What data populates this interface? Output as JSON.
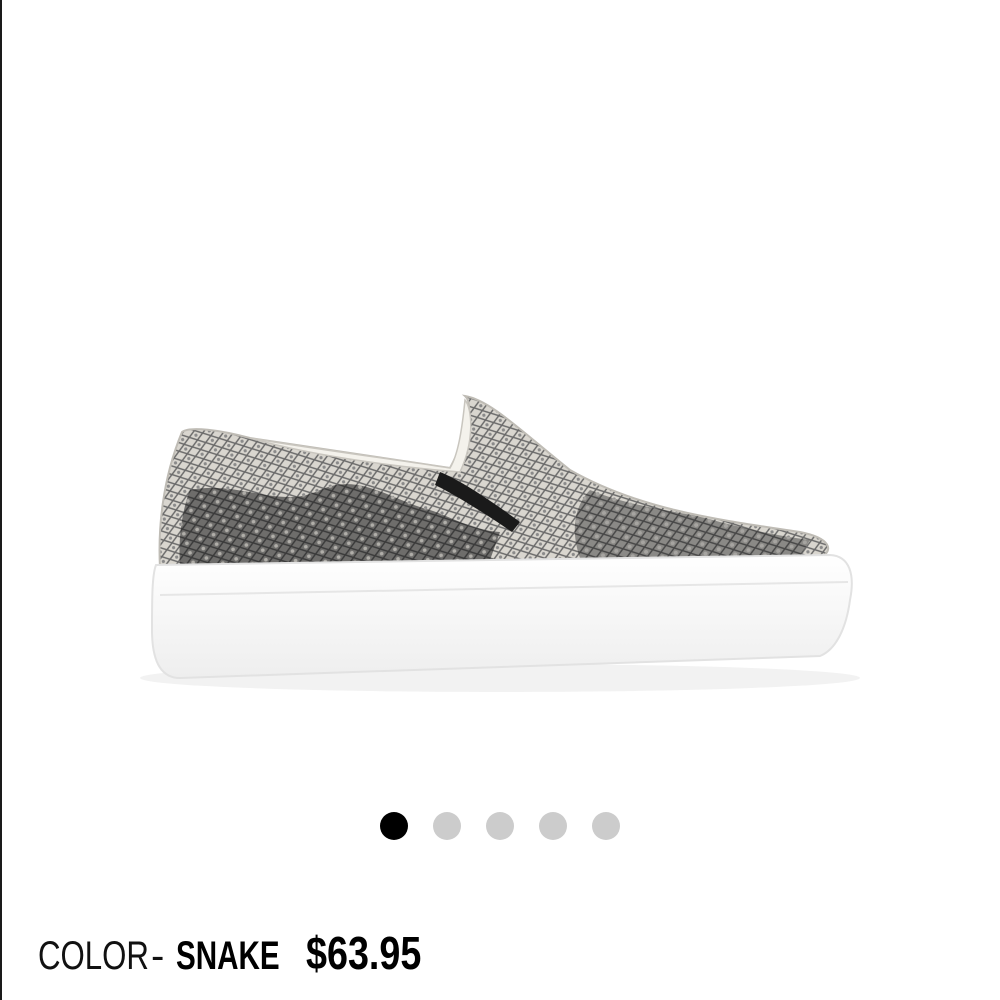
{
  "product": {
    "color_label": "COLOR",
    "color_separator": "-",
    "color_value": "SNAKE",
    "price": "$63.95",
    "image_icon": "slip-on-sneaker-snake-print"
  },
  "carousel": {
    "total_images": 5,
    "active_index": 0,
    "active_color": "#000000",
    "inactive_color": "#cccccc"
  }
}
